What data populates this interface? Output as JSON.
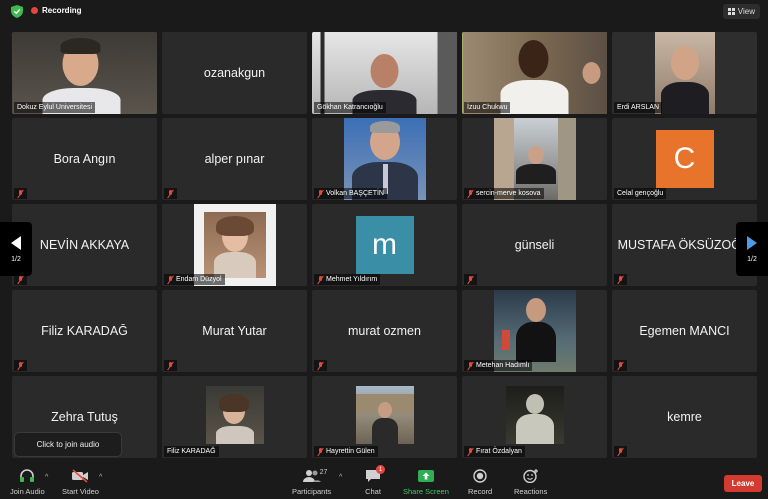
{
  "topbar": {
    "recording_label": "Recording",
    "view_label": "View"
  },
  "tiles": [
    {
      "name": "Dokuz Eylul Universitesi",
      "kind": "video",
      "muted": false
    },
    {
      "name": "ozanakgun",
      "kind": "name",
      "muted": false
    },
    {
      "name": "Gökhan Katrancıoğlu",
      "kind": "video",
      "muted": false
    },
    {
      "name": "İzuu Chukwu",
      "kind": "video",
      "muted": false,
      "active": true
    },
    {
      "name": "Erdi ARSLAN",
      "kind": "video",
      "muted": false
    },
    {
      "name": "Bora Angın",
      "kind": "name",
      "muted": true
    },
    {
      "name": "alper pınar",
      "kind": "name",
      "muted": true
    },
    {
      "name": "Volkan BAŞÇETİN",
      "kind": "photo",
      "muted": true
    },
    {
      "name": "sercin-merve kosova",
      "kind": "photo",
      "muted": true
    },
    {
      "name": "Celal gençoğlu",
      "kind": "avatar",
      "avatar_letter": "C",
      "avatar_color": "#e8742c",
      "muted": false
    },
    {
      "name": "NEVİN AKKAYA",
      "kind": "name",
      "muted": true
    },
    {
      "name": "Endam Düzyol",
      "kind": "photo",
      "muted": true
    },
    {
      "name": "Mehmet Yıldırım",
      "kind": "avatar",
      "avatar_letter": "m",
      "avatar_color": "#3a8ea6",
      "muted": true
    },
    {
      "name": "günseli",
      "kind": "name",
      "muted": true
    },
    {
      "name": "MUSTAFA ÖKSÜZOĞ...",
      "kind": "name",
      "muted": true
    },
    {
      "name": "Filiz KARADAĞ",
      "kind": "name",
      "muted": true
    },
    {
      "name": "Murat Yutar",
      "kind": "name",
      "muted": true
    },
    {
      "name": "murat ozmen",
      "kind": "name",
      "muted": true
    },
    {
      "name": "Metehan Hadımlı",
      "kind": "photo",
      "muted": true
    },
    {
      "name": "Egemen MANCI",
      "kind": "name",
      "muted": true
    },
    {
      "name": "Zehra Tutuş",
      "kind": "name",
      "muted": true
    },
    {
      "name": "Filiz KARADAĞ",
      "kind": "photo",
      "muted": false
    },
    {
      "name": "Hayrettin Gülen",
      "kind": "photo",
      "muted": true
    },
    {
      "name": "Fırat Özdalyan",
      "kind": "photo",
      "muted": true
    },
    {
      "name": "kemre",
      "kind": "name",
      "muted": true
    }
  ],
  "pager": {
    "left_label": "1/2",
    "right_label": "1/2"
  },
  "tooltip": "Click to join audio",
  "toolbar": {
    "join_audio": "Join Audio",
    "start_video": "Start Video",
    "participants": "Participants",
    "participants_count": "27",
    "chat": "Chat",
    "chat_badge": "1",
    "share_screen": "Share Screen",
    "record": "Record",
    "reactions": "Reactions",
    "leave": "Leave"
  },
  "colors": {
    "active_border": "#b9d36a",
    "share_green": "#2fae55",
    "leave_red": "#d33a30",
    "recording_red": "#e5453d"
  }
}
